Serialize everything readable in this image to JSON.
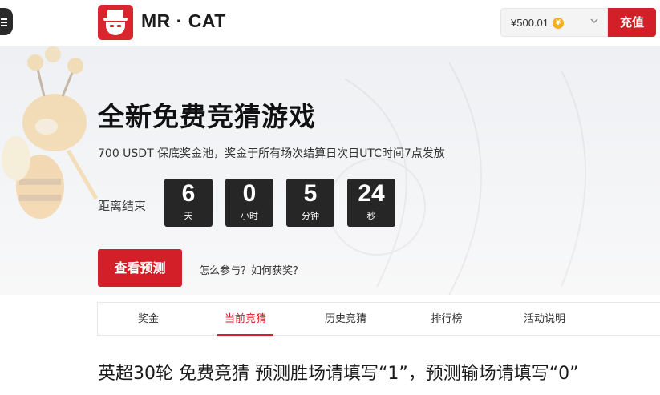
{
  "header": {
    "brand": "MR · CAT",
    "balance": "¥500.01",
    "coin_icon": "¥",
    "recharge_label": "充值"
  },
  "hero": {
    "title": "全新免费竞猜游戏",
    "subtitle": "700 USDT 保底奖金池，奖金于所有场次结算日次日UTC时间7点发放",
    "countdown_label": "距离结束",
    "countdown": [
      {
        "value": "6",
        "unit": "天"
      },
      {
        "value": "0",
        "unit": "小时"
      },
      {
        "value": "5",
        "unit": "分钟"
      },
      {
        "value": "24",
        "unit": "秒"
      }
    ],
    "predict_label": "查看预测",
    "how_label": "怎么参与？如何获奖？"
  },
  "tabs": [
    {
      "label": "奖金",
      "active": false
    },
    {
      "label": "当前竞猜",
      "active": true
    },
    {
      "label": "历史竞猜",
      "active": false
    },
    {
      "label": "排行榜",
      "active": false
    },
    {
      "label": "活动说明",
      "active": false
    }
  ],
  "section": {
    "title": "英超30轮 免费竞猜 预测胜场请填写“1”，预测输场请填写“0”"
  },
  "colors": {
    "accent": "#d31f27",
    "countdown_bg": "#262626",
    "coin": "#f2b01e"
  }
}
